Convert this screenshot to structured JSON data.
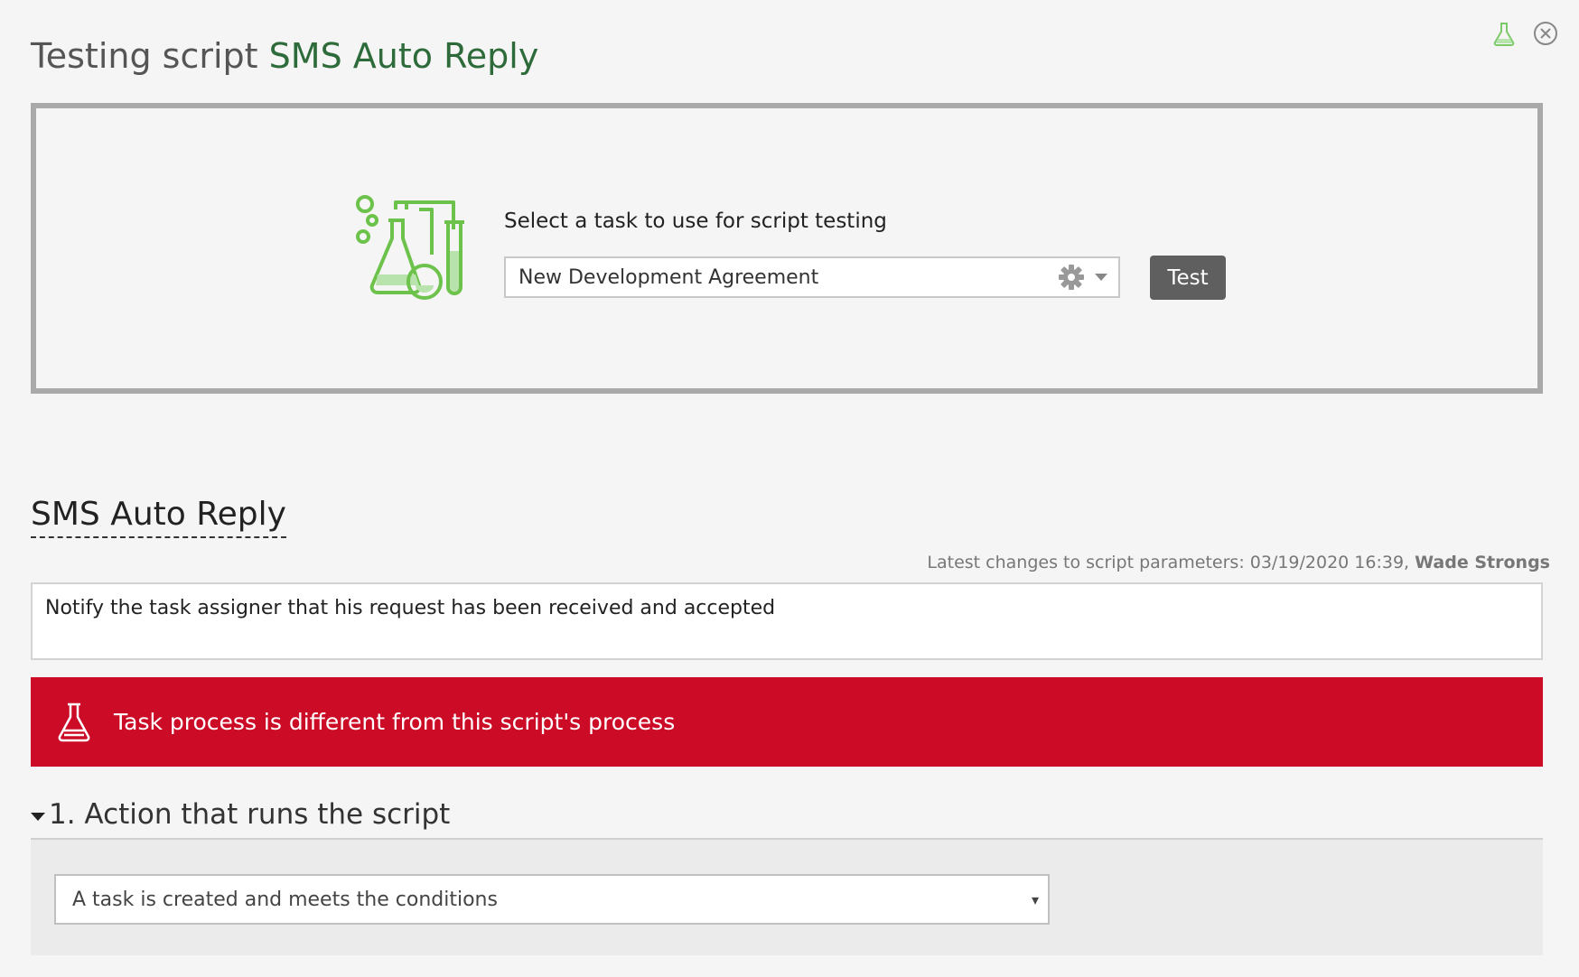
{
  "header": {
    "title_prefix": "Testing script",
    "script_name": "SMS Auto Reply",
    "icons": [
      "flask-icon",
      "close-circle-icon"
    ]
  },
  "test_panel": {
    "illustration": "lab-flasks-icon",
    "select_label": "Select a task to use for script testing",
    "selected_task": "New Development Agreement",
    "select_icons": [
      "gear-icon",
      "caret-down-icon"
    ],
    "test_button_label": "Test"
  },
  "script": {
    "heading": "SMS Auto Reply",
    "latest_changes_label": "Latest changes to script parameters: 03/19/2020 16:39,",
    "latest_changes_user": "Wade Strongs",
    "description": "Notify the task assigner that his request has been received and accepted"
  },
  "alert": {
    "icon": "flask-icon",
    "message": "Task process is different from this script's process",
    "color": "#cc0c27"
  },
  "section": {
    "title": "1. Action that runs the script",
    "action_value": "A task is created and meets the conditions",
    "action_arrow": "▾"
  },
  "colors": {
    "accent_green": "#2e6b3a",
    "icon_green": "#6cc24a",
    "button": "#5f5f5f",
    "alert": "#cc0c27"
  }
}
